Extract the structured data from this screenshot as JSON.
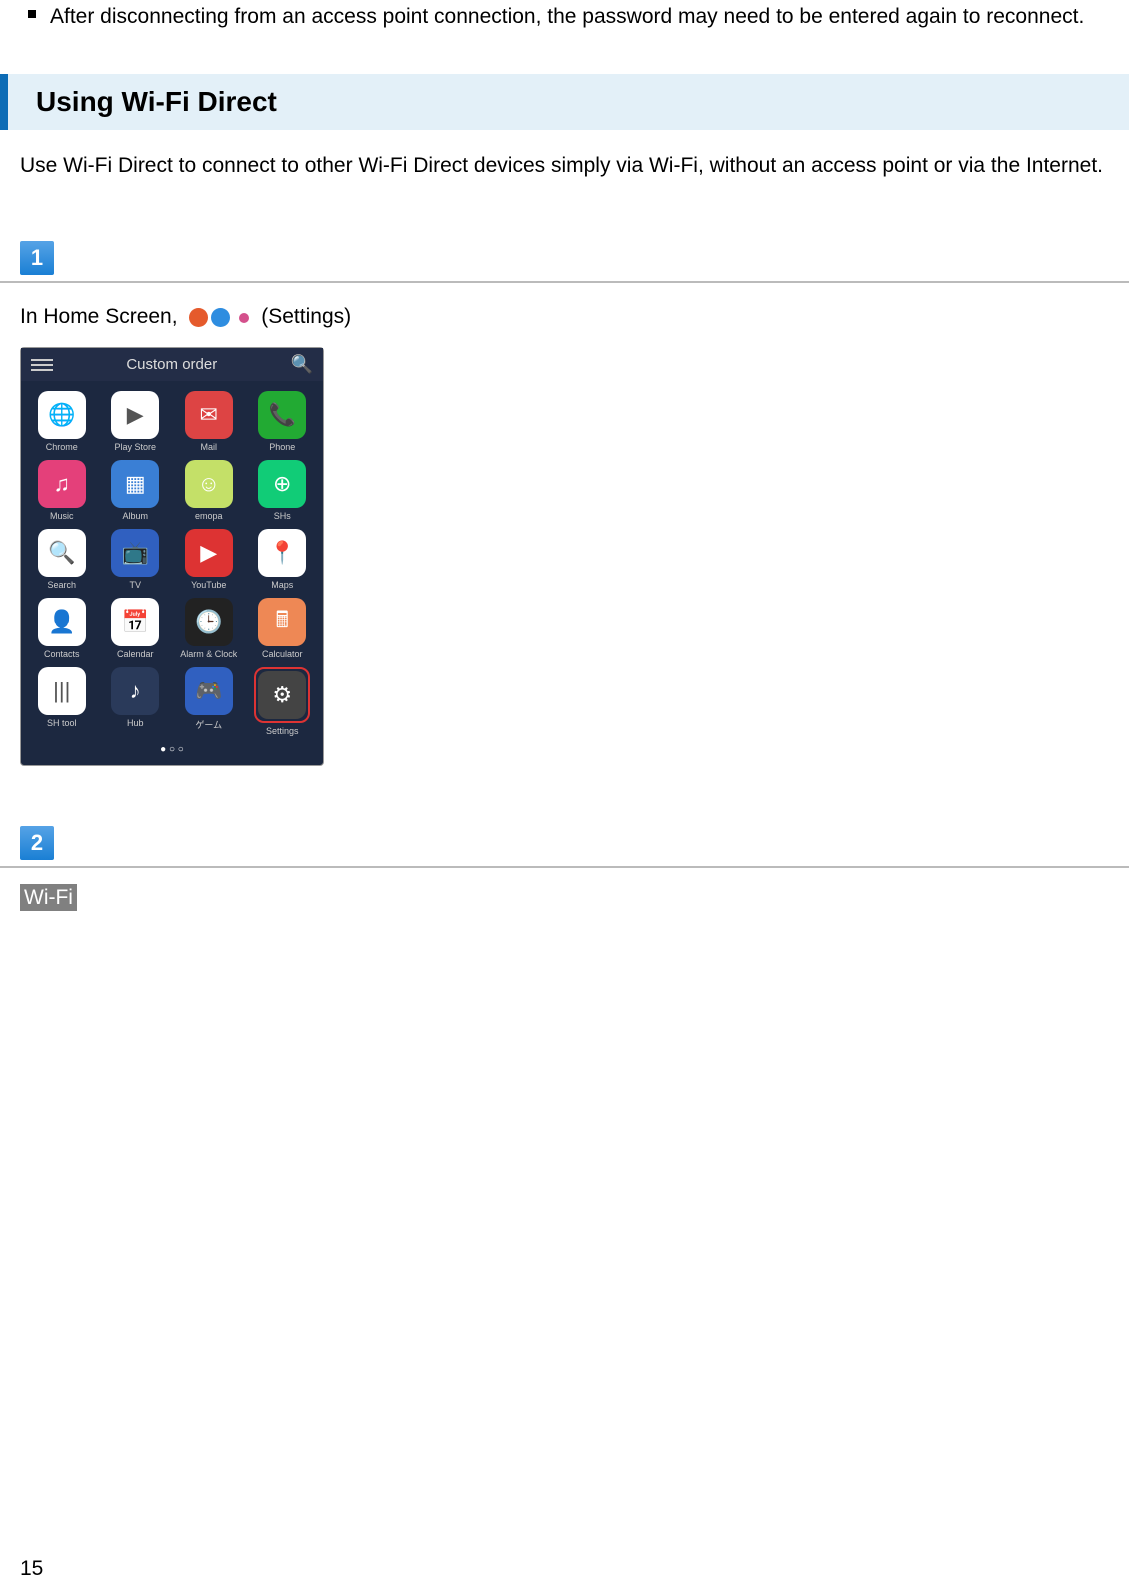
{
  "bullet_text": "After disconnecting from an access point connection, the password may need to be entered again to reconnect.",
  "section_heading": "Using Wi-Fi Direct",
  "section_text": "Use Wi-Fi Direct to connect to other Wi-Fi Direct devices simply via Wi-Fi, without an access point or via the Internet.",
  "step1_number": "1",
  "step1_text_pre": "In Home Screen, ",
  "step1_text_post": " (Settings)",
  "screenshot": {
    "top_label": "Custom order",
    "apps": [
      {
        "label": "Chrome",
        "bg": "#fff",
        "emoji": "🌐"
      },
      {
        "label": "Play Store",
        "bg": "#fff",
        "emoji": "▶"
      },
      {
        "label": "Mail",
        "bg": "#d44",
        "emoji": "✉"
      },
      {
        "label": "Phone",
        "bg": "#2a3",
        "emoji": "📞"
      },
      {
        "label": "Music",
        "bg": "#e4407a",
        "emoji": "♫"
      },
      {
        "label": "Album",
        "bg": "#3a7fd5",
        "emoji": "▦"
      },
      {
        "label": "emopa",
        "bg": "#c4e068",
        "emoji": "☺"
      },
      {
        "label": "SHs",
        "bg": "#1c7",
        "emoji": "⊕"
      },
      {
        "label": "Search",
        "bg": "#fff",
        "emoji": "🔍"
      },
      {
        "label": "TV",
        "bg": "#3060c0",
        "emoji": "📺"
      },
      {
        "label": "YouTube",
        "bg": "#d33",
        "emoji": "▶"
      },
      {
        "label": "Maps",
        "bg": "#fff",
        "emoji": "📍"
      },
      {
        "label": "Contacts",
        "bg": "#fff",
        "emoji": "👤"
      },
      {
        "label": "Calendar",
        "bg": "#fff",
        "emoji": "📅"
      },
      {
        "label": "Alarm & Clock",
        "bg": "#222",
        "emoji": "🕒"
      },
      {
        "label": "Calculator",
        "bg": "#e85",
        "emoji": "🖩"
      },
      {
        "label": "SH tool",
        "bg": "#fff",
        "emoji": "|||"
      },
      {
        "label": "Hub",
        "bg": "#2a3a5a",
        "emoji": "♪"
      },
      {
        "label": "ゲーム",
        "bg": "#3060c0",
        "emoji": "🎮"
      },
      {
        "label": "Settings",
        "bg": "#444",
        "emoji": "⚙"
      }
    ]
  },
  "step2_number": "2",
  "step2_text": "Wi-Fi",
  "page_number": "15"
}
